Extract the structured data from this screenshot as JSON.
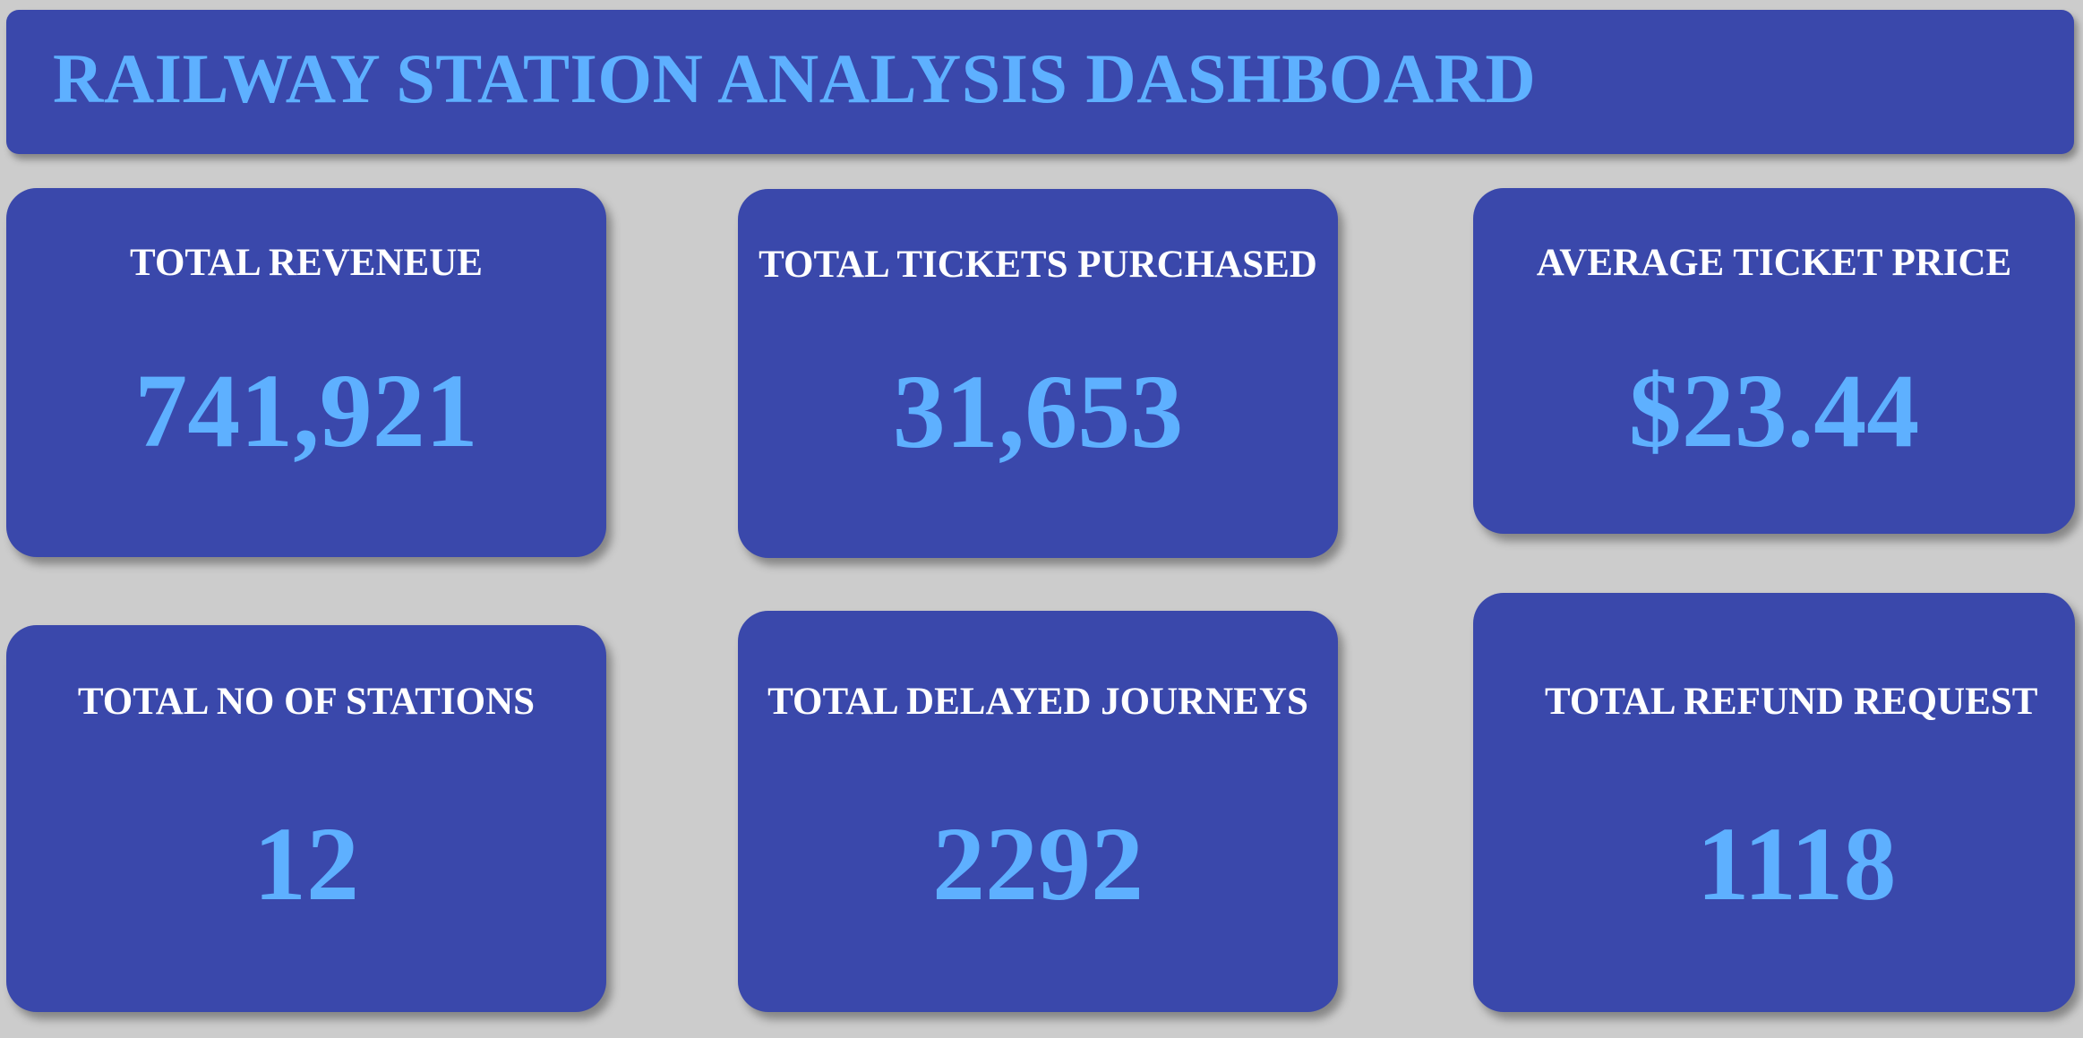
{
  "header": {
    "title": "RAILWAY STATION ANALYSIS DASHBOARD"
  },
  "kpis": [
    {
      "label": "TOTAL REVENEUE",
      "value": "741,921"
    },
    {
      "label": "TOTAL TICKETS PURCHASED",
      "value": "31,653"
    },
    {
      "label": "AVERAGE TICKET PRICE",
      "value": "$23.44"
    },
    {
      "label": "TOTAL NO OF STATIONS",
      "value": "12"
    },
    {
      "label": "TOTAL DELAYED JOURNEYS",
      "value": "2292"
    },
    {
      "label": "TOTAL REFUND REQUEST",
      "value": "1118"
    }
  ],
  "colors": {
    "background": "#cccccc",
    "panel": "#3a48ab",
    "accent_text": "#5eb0ff",
    "label_text": "#ffffff"
  }
}
